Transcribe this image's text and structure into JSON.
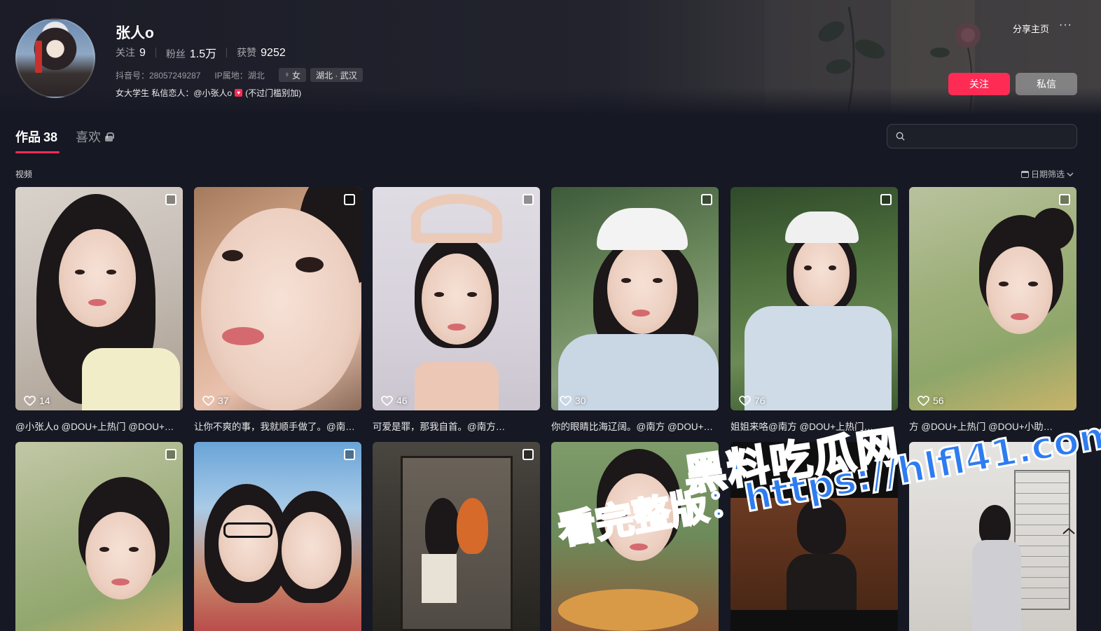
{
  "profile": {
    "name": "张人o",
    "following_label": "关注",
    "following_count": "9",
    "followers_label": "粉丝",
    "followers_count": "1.5万",
    "likes_label": "获赞",
    "likes_count": "9252",
    "douyin_id": "抖音号：28057249287",
    "ip_location": "IP属地：湖北",
    "gender_tag": "女",
    "location_tag": "湖北 · 武汉",
    "bio_prefix": "女大学生 私信恋人：@小张人o",
    "bio_suffix": "(不过门槛别加)"
  },
  "actions": {
    "share": "分享主页",
    "more": "···",
    "follow": "关注",
    "message": "私信"
  },
  "tabs": {
    "works_label": "作品",
    "works_count": "38",
    "likes_label": "喜欢"
  },
  "search": {
    "placeholder": ""
  },
  "section": {
    "label": "视频",
    "date_filter": "日期筛选"
  },
  "videos": [
    {
      "likes": "14",
      "caption": "@小张人o @DOU+上热门 @DOU+…"
    },
    {
      "likes": "37",
      "caption": "让你不爽的事，我就顺手做了。@南…"
    },
    {
      "likes": "46",
      "caption": "可爱是罪，那我自首。@南方…"
    },
    {
      "likes": "30",
      "caption": "你的眼睛比海辽阔。@南方 @DOU+…"
    },
    {
      "likes": "76",
      "caption": "姐姐来咯@南方 @DOU+上热门…"
    },
    {
      "likes": "56",
      "caption": "方 @DOU+上热门 @DOU+小助…"
    }
  ],
  "watermark": {
    "line1": "黑料吃瓜网",
    "line2": "看完整版：https://hlfl41.com"
  },
  "colors": {
    "accent": "#fe2c55",
    "background": "#161823"
  }
}
